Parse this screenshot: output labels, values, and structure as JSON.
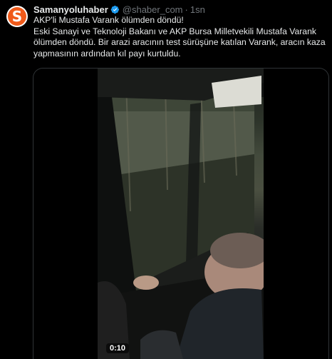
{
  "author": {
    "name": "Samanyoluhaber",
    "handle": "@shaber_com",
    "separator": "·",
    "time": "1sn",
    "avatar_letter": "S"
  },
  "tweet": {
    "line1": "AKP'li Mustafa Varank ölümden döndü!",
    "line2": "Eski Sanayi ve Teknoloji Bakanı ve AKP Bursa Milletvekili Mustafa Varank ölümden döndü. Bir arazi aracının test sürüşüne katılan Varank, aracın kaza yapmasının ardından kıl payı kurtuldu."
  },
  "video": {
    "duration": "0:10"
  },
  "colors": {
    "background": "#000000",
    "text": "#e7e9ea",
    "muted": "#71767b",
    "verified": "#1d9bf0",
    "brand": "#f05a1a",
    "border": "#2f3336"
  }
}
